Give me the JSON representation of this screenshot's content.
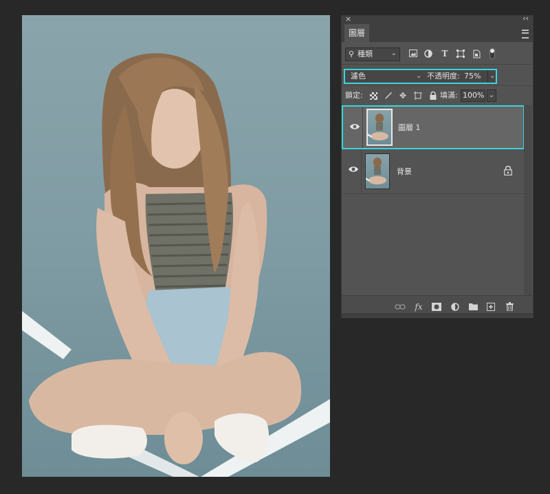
{
  "canvas": {
    "content": "photo-canvas"
  },
  "panel": {
    "close_glyph": "×",
    "collapse_glyph": "‹‹",
    "tab_label": "圖層",
    "filter": {
      "search_glyph": "⚲",
      "kind_label": "種類",
      "chevron": "⌄",
      "icons": [
        "image-filter-icon",
        "adjustment-filter-icon",
        "type-filter-icon",
        "shape-filter-icon",
        "smart-object-filter-icon",
        "filter-toggle-icon"
      ]
    },
    "blend": {
      "mode": "濾色",
      "chevron": "⌄",
      "opacity_label": "不透明度:",
      "opacity_value": "75%"
    },
    "lock": {
      "label": "鎖定:",
      "icons": [
        "lock-transparent-icon",
        "lock-image-icon",
        "lock-position-icon",
        "lock-artboard-icon",
        "lock-all-icon"
      ],
      "fill_label": "填滿:",
      "fill_value": "100%",
      "chevron": "⌄"
    },
    "layers": [
      {
        "name": "圖層 1",
        "selected": true,
        "visible": true
      },
      {
        "name": "背景",
        "selected": false,
        "visible": true,
        "locked": true
      }
    ],
    "bottom_icons": [
      "link-layers-icon",
      "fx-icon",
      "add-mask-icon",
      "adjustment-layer-icon",
      "new-group-icon",
      "new-layer-icon",
      "delete-layer-icon"
    ],
    "fx_text": "fx"
  },
  "colors": {
    "accent": "#39d4dd",
    "panel_bg": "#535353",
    "app_bg": "#282828"
  }
}
